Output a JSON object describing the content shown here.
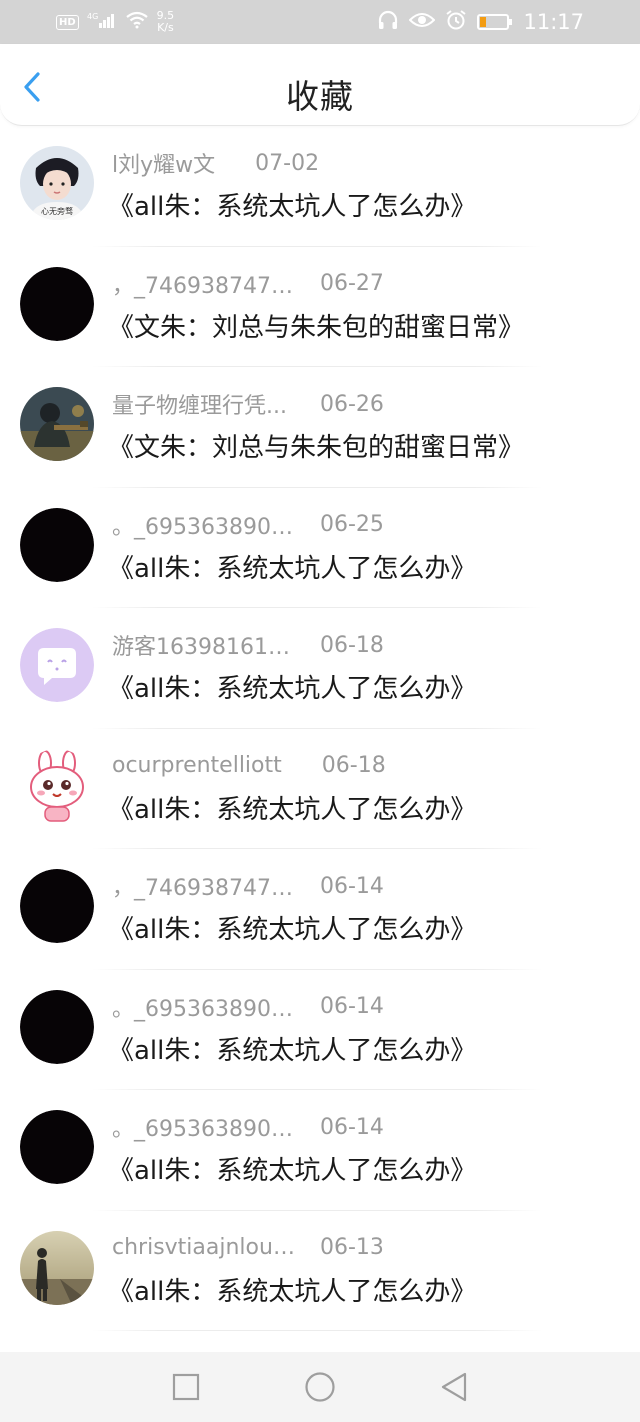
{
  "status_bar": {
    "hd_label": "HD",
    "network_label": "4G",
    "speed_value": "9.5",
    "speed_unit": "K/s",
    "time": "11:17",
    "battery_level": 0.2
  },
  "header": {
    "title": "收藏"
  },
  "colors": {
    "accent": "#3a9ff0",
    "battery_fill": "#f39c12"
  },
  "favorites": [
    {
      "username": "l刘y耀w文",
      "date": "07-02",
      "title": "《all朱：系统太坑人了怎么办》",
      "avatar": "photo-boy"
    },
    {
      "username": "，_7469387471...",
      "date": "06-27",
      "title": "《文朱：刘总与朱朱包的甜蜜日常》",
      "avatar": "black"
    },
    {
      "username": "量子物缠理行凭...",
      "date": "06-26",
      "title": "《文朱：刘总与朱朱包的甜蜜日常》",
      "avatar": "photo-soldier"
    },
    {
      "username": "。_6953638907...",
      "date": "06-25",
      "title": "《all朱：系统太坑人了怎么办》",
      "avatar": "black"
    },
    {
      "username": "游客163981619...",
      "date": "06-18",
      "title": "《all朱：系统太坑人了怎么办》",
      "avatar": "chat-bubble"
    },
    {
      "username": "ocurprentelliott",
      "date": "06-18",
      "title": "《all朱：系统太坑人了怎么办》",
      "avatar": "bunny"
    },
    {
      "username": "，_7469387471...",
      "date": "06-14",
      "title": "《all朱：系统太坑人了怎么办》",
      "avatar": "black"
    },
    {
      "username": "。_6953638907...",
      "date": "06-14",
      "title": "《all朱：系统太坑人了怎么办》",
      "avatar": "black"
    },
    {
      "username": "。_6953638907...",
      "date": "06-14",
      "title": "《all朱：系统太坑人了怎么办》",
      "avatar": "black"
    },
    {
      "username": "chrisvtiaajnloub...",
      "date": "06-13",
      "title": "《all朱：系统太坑人了怎么办》",
      "avatar": "photo-road"
    }
  ],
  "avatar_captions": {
    "photo-boy": "心无旁骛"
  },
  "nav_bar": {
    "icons": [
      "square-icon",
      "circle-icon",
      "triangle-back-icon"
    ]
  }
}
